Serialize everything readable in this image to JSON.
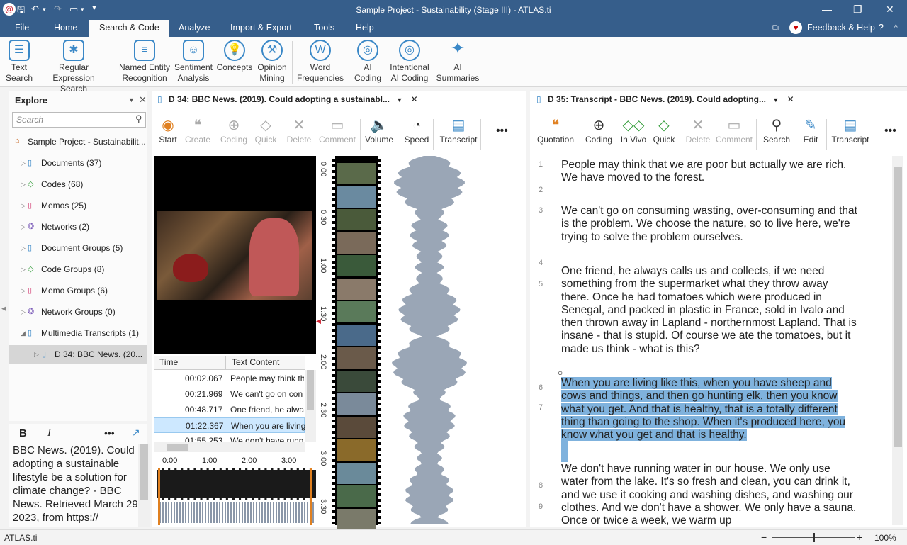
{
  "window": {
    "title": "Sample Project - Sustainability (Stage III) - ATLAS.ti",
    "controls": [
      "minimize-icon",
      "restore-icon",
      "close-icon"
    ]
  },
  "menu": {
    "items": [
      "File",
      "Home",
      "Search & Code",
      "Analyze",
      "Import & Export",
      "Tools",
      "Help"
    ],
    "active": "Search & Code",
    "feedback": "Feedback & Help"
  },
  "ribbon": {
    "buttons": [
      {
        "l1": "Text",
        "l2": "Search",
        "icon": "text-search-icon"
      },
      {
        "l1": "Regular",
        "l2": "Expression Search",
        "icon": "regex-search-icon"
      },
      {
        "l1": "Named Entity",
        "l2": "Recognition",
        "icon": "ner-icon"
      },
      {
        "l1": "Sentiment",
        "l2": "Analysis",
        "icon": "sentiment-icon"
      },
      {
        "l1": "Concepts",
        "l2": "",
        "icon": "concepts-icon"
      },
      {
        "l1": "Opinion",
        "l2": "Mining",
        "icon": "opinion-mining-icon"
      },
      {
        "l1": "Word",
        "l2": "Frequencies",
        "icon": "word-frequencies-icon"
      },
      {
        "l1": "AI",
        "l2": "Coding",
        "icon": "ai-coding-icon"
      },
      {
        "l1": "Intentional",
        "l2": "AI Coding",
        "icon": "intentional-ai-coding-icon"
      },
      {
        "l1": "AI",
        "l2": "Summaries",
        "icon": "ai-summaries-icon"
      }
    ]
  },
  "explore": {
    "title": "Explore",
    "search_placeholder": "Search",
    "project": "Sample Project - Sustainabilit...",
    "items": [
      {
        "label": "Documents (37)",
        "color": "#3a88c7"
      },
      {
        "label": "Codes (68)",
        "color": "#3aa040"
      },
      {
        "label": "Memos (25)",
        "color": "#d0306a"
      },
      {
        "label": "Networks (2)",
        "color": "#7a5ab8"
      },
      {
        "label": "Document Groups (5)",
        "color": "#3a88c7"
      },
      {
        "label": "Code Groups (8)",
        "color": "#3aa040"
      },
      {
        "label": "Memo Groups (6)",
        "color": "#d0306a"
      },
      {
        "label": "Network Groups (0)",
        "color": "#7a5ab8"
      },
      {
        "label": "Multimedia Transcripts (1)",
        "color": "#3a88c7"
      }
    ],
    "selected_child": "D 34: BBC News. (20..."
  },
  "notes": {
    "bold": "B",
    "italic": "I",
    "more": "•••",
    "text": "BBC News. (2019). Could adopting a sustainable lifestyle be a solution for climate change? - BBC News. Retrieved March 29, 2023, from https://"
  },
  "doc34": {
    "tab": "D 34: BBC News. (2019). Could adopting a sustainabl...",
    "toolbar": [
      {
        "label": "Start",
        "icon": "start-icon",
        "enabled": true
      },
      {
        "label": "Create",
        "icon": "create-quotation-icon",
        "enabled": false
      },
      {
        "label": "Coding",
        "icon": "coding-icon",
        "enabled": false
      },
      {
        "label": "Quick",
        "icon": "quick-coding-icon",
        "enabled": false
      },
      {
        "label": "Delete",
        "icon": "delete-icon",
        "enabled": false
      },
      {
        "label": "Comment",
        "icon": "comment-icon",
        "enabled": false
      },
      {
        "label": "Volume",
        "icon": "volume-icon",
        "enabled": true
      },
      {
        "label": "Speed",
        "icon": "speed-icon",
        "enabled": true
      },
      {
        "label": "Transcript",
        "icon": "transcript-icon",
        "enabled": true
      }
    ],
    "table": {
      "headers": [
        "Time",
        "Text Content"
      ],
      "rows": [
        {
          "time": "00:02.067",
          "text": "People may think th"
        },
        {
          "time": "00:21.969",
          "text": "We can't go on con"
        },
        {
          "time": "00:48.717",
          "text": "One friend, he alway"
        },
        {
          "time": "01:22.367",
          "text": "When you are living"
        },
        {
          "time": "01:55.253",
          "text": "We don't have runn"
        }
      ],
      "selected": 3
    },
    "ruler": [
      "0:00",
      "0:30",
      "1:00",
      "1:30",
      "2:00",
      "2:30",
      "3:00",
      "3:30"
    ],
    "timeline": [
      "0:00",
      "1:00",
      "2:00",
      "3:00"
    ]
  },
  "doc35": {
    "tab": "D 35: Transcript - BBC News. (2019). Could adopting...",
    "toolbar": [
      {
        "label": "Quotation",
        "icon": "quotation-icon",
        "enabled": true
      },
      {
        "label": "Coding",
        "icon": "coding-icon",
        "enabled": true
      },
      {
        "label": "In Vivo",
        "icon": "in-vivo-icon",
        "enabled": true
      },
      {
        "label": "Quick",
        "icon": "quick-coding-icon",
        "enabled": true
      },
      {
        "label": "Delete",
        "icon": "delete-icon",
        "enabled": false
      },
      {
        "label": "Comment",
        "icon": "comment-icon",
        "enabled": false
      },
      {
        "label": "Search",
        "icon": "search-icon",
        "enabled": true
      },
      {
        "label": "Edit",
        "icon": "edit-icon",
        "enabled": true
      },
      {
        "label": "Transcript",
        "icon": "transcript-icon",
        "enabled": true
      }
    ],
    "line_numbers": [
      "1",
      "2",
      "3",
      "4",
      "5",
      "6",
      "7",
      "8",
      "9"
    ],
    "paragraphs": [
      "People may think that we are poor but actually we are rich. We have moved to the forest.",
      "We can't go on consuming wasting, over-consuming and that is the problem. We choose the nature, so to live here, we're trying to solve the problem ourselves.",
      "One friend, he always calls us and collects, if we need something from the supermarket what they throw away there. Once he had tomatoes which were produced in Senegal, and packed in plastic in France, sold in Ivalo and then thrown away in Lapland - northernmost Lapland. That is insane - that is stupid. Of course we ate the tomatoes, but it made us think - what is this?",
      "When you are living like this, when you have sheep and cows and things, and then go hunting elk, then you know what you get. And that is healthy, that is a totally different thing than going to the shop. When it's produced here, you know what you get and that is healthy.",
      "We don't have running water in our house. We only use water from the lake. It's so fresh and clean, you can drink it, and we use it cooking and washing dishes, and washing our clothes. And we don't have a shower. We only have a sauna. Once or twice a week, we warm up"
    ]
  },
  "status": {
    "left": "ATLAS.ti",
    "zoom": "100%",
    "zoom_level": 0.5
  }
}
